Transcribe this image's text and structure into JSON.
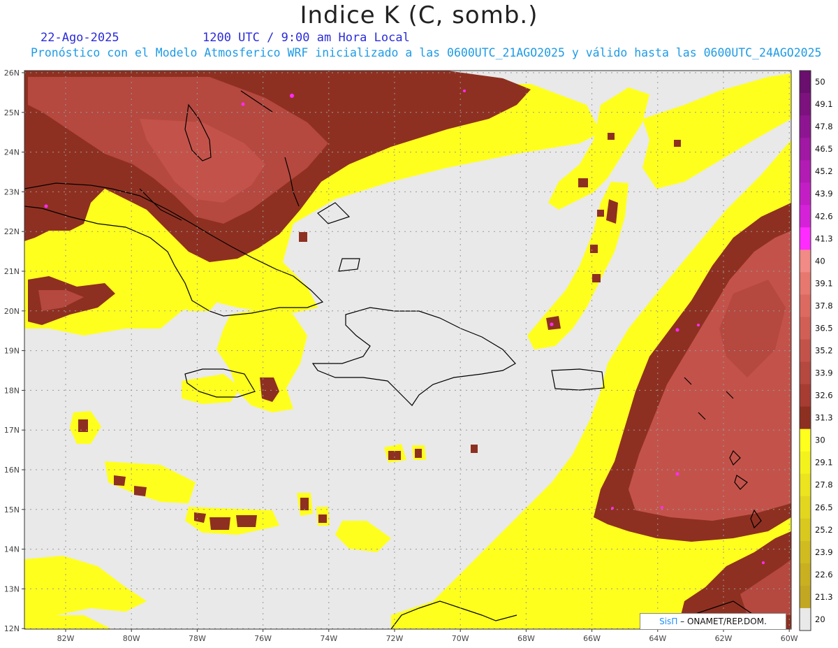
{
  "header": {
    "title": "Indice K (C, somb.)",
    "date": "22-Ago-2025",
    "time": "1200 UTC / 9:00 am Hora Local",
    "subtitle": "Pronóstico con el Modelo Atmosferico WRF inicializado a las 0600UTC_21AGO2025 y válido hasta las  0600UTC_24AGO2025"
  },
  "axes": {
    "lon_labels": [
      "82W",
      "80W",
      "78W",
      "76W",
      "74W",
      "72W",
      "70W",
      "68W",
      "66W",
      "64W",
      "62W",
      "60W"
    ],
    "lat_labels": [
      "26N",
      "25N",
      "24N",
      "23N",
      "22N",
      "21N",
      "20N",
      "19N",
      "18N",
      "17N",
      "16N",
      "15N",
      "14N",
      "13N",
      "12N"
    ]
  },
  "colorbar": {
    "labels": [
      "50",
      "49.1",
      "47.8",
      "46.5",
      "45.2",
      "43.9",
      "42.6",
      "41.3",
      "40",
      "39.1",
      "37.8",
      "36.5",
      "35.2",
      "33.9",
      "32.6",
      "31.3",
      "30",
      "29.1",
      "27.8",
      "26.5",
      "25.2",
      "23.9",
      "22.6",
      "21.3",
      "20"
    ],
    "colors": [
      "#6a0f6e",
      "#7d127f",
      "#8e1591",
      "#a018a3",
      "#b21bb4",
      "#c31ec6",
      "#d521d8",
      "#ff2bff",
      "#f28a85",
      "#e7786f",
      "#dc6a60",
      "#d15f55",
      "#c3534a",
      "#b5483f",
      "#a73c33",
      "#8e3021",
      "#ffff1e",
      "#f4f21c",
      "#ebe41e",
      "#e2d61f",
      "#d9c91f",
      "#d0bc20",
      "#c8b021",
      "#c2a722",
      "#e9e9e9"
    ]
  },
  "credit": {
    "brand": "SisΠ",
    "text": "– ONAMET/REP.DOM."
  }
}
